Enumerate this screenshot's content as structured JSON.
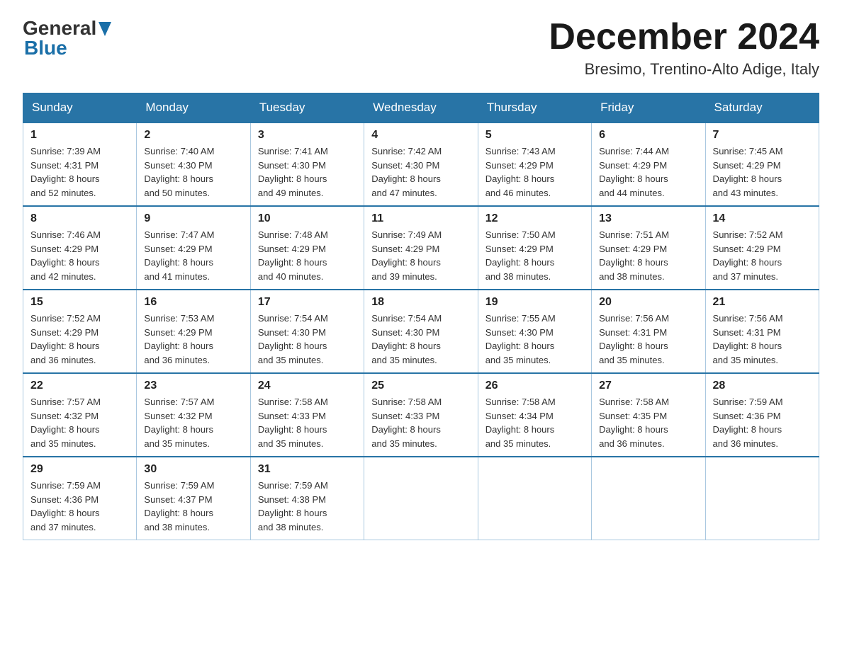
{
  "header": {
    "logo_general": "General",
    "logo_blue": "Blue",
    "month_title": "December 2024",
    "subtitle": "Bresimo, Trentino-Alto Adige, Italy"
  },
  "days_of_week": [
    "Sunday",
    "Monday",
    "Tuesday",
    "Wednesday",
    "Thursday",
    "Friday",
    "Saturday"
  ],
  "weeks": [
    [
      {
        "day": "1",
        "sunrise": "Sunrise: 7:39 AM",
        "sunset": "Sunset: 4:31 PM",
        "daylight": "Daylight: 8 hours",
        "minutes": "and 52 minutes."
      },
      {
        "day": "2",
        "sunrise": "Sunrise: 7:40 AM",
        "sunset": "Sunset: 4:30 PM",
        "daylight": "Daylight: 8 hours",
        "minutes": "and 50 minutes."
      },
      {
        "day": "3",
        "sunrise": "Sunrise: 7:41 AM",
        "sunset": "Sunset: 4:30 PM",
        "daylight": "Daylight: 8 hours",
        "minutes": "and 49 minutes."
      },
      {
        "day": "4",
        "sunrise": "Sunrise: 7:42 AM",
        "sunset": "Sunset: 4:30 PM",
        "daylight": "Daylight: 8 hours",
        "minutes": "and 47 minutes."
      },
      {
        "day": "5",
        "sunrise": "Sunrise: 7:43 AM",
        "sunset": "Sunset: 4:29 PM",
        "daylight": "Daylight: 8 hours",
        "minutes": "and 46 minutes."
      },
      {
        "day": "6",
        "sunrise": "Sunrise: 7:44 AM",
        "sunset": "Sunset: 4:29 PM",
        "daylight": "Daylight: 8 hours",
        "minutes": "and 44 minutes."
      },
      {
        "day": "7",
        "sunrise": "Sunrise: 7:45 AM",
        "sunset": "Sunset: 4:29 PM",
        "daylight": "Daylight: 8 hours",
        "minutes": "and 43 minutes."
      }
    ],
    [
      {
        "day": "8",
        "sunrise": "Sunrise: 7:46 AM",
        "sunset": "Sunset: 4:29 PM",
        "daylight": "Daylight: 8 hours",
        "minutes": "and 42 minutes."
      },
      {
        "day": "9",
        "sunrise": "Sunrise: 7:47 AM",
        "sunset": "Sunset: 4:29 PM",
        "daylight": "Daylight: 8 hours",
        "minutes": "and 41 minutes."
      },
      {
        "day": "10",
        "sunrise": "Sunrise: 7:48 AM",
        "sunset": "Sunset: 4:29 PM",
        "daylight": "Daylight: 8 hours",
        "minutes": "and 40 minutes."
      },
      {
        "day": "11",
        "sunrise": "Sunrise: 7:49 AM",
        "sunset": "Sunset: 4:29 PM",
        "daylight": "Daylight: 8 hours",
        "minutes": "and 39 minutes."
      },
      {
        "day": "12",
        "sunrise": "Sunrise: 7:50 AM",
        "sunset": "Sunset: 4:29 PM",
        "daylight": "Daylight: 8 hours",
        "minutes": "and 38 minutes."
      },
      {
        "day": "13",
        "sunrise": "Sunrise: 7:51 AM",
        "sunset": "Sunset: 4:29 PM",
        "daylight": "Daylight: 8 hours",
        "minutes": "and 38 minutes."
      },
      {
        "day": "14",
        "sunrise": "Sunrise: 7:52 AM",
        "sunset": "Sunset: 4:29 PM",
        "daylight": "Daylight: 8 hours",
        "minutes": "and 37 minutes."
      }
    ],
    [
      {
        "day": "15",
        "sunrise": "Sunrise: 7:52 AM",
        "sunset": "Sunset: 4:29 PM",
        "daylight": "Daylight: 8 hours",
        "minutes": "and 36 minutes."
      },
      {
        "day": "16",
        "sunrise": "Sunrise: 7:53 AM",
        "sunset": "Sunset: 4:29 PM",
        "daylight": "Daylight: 8 hours",
        "minutes": "and 36 minutes."
      },
      {
        "day": "17",
        "sunrise": "Sunrise: 7:54 AM",
        "sunset": "Sunset: 4:30 PM",
        "daylight": "Daylight: 8 hours",
        "minutes": "and 35 minutes."
      },
      {
        "day": "18",
        "sunrise": "Sunrise: 7:54 AM",
        "sunset": "Sunset: 4:30 PM",
        "daylight": "Daylight: 8 hours",
        "minutes": "and 35 minutes."
      },
      {
        "day": "19",
        "sunrise": "Sunrise: 7:55 AM",
        "sunset": "Sunset: 4:30 PM",
        "daylight": "Daylight: 8 hours",
        "minutes": "and 35 minutes."
      },
      {
        "day": "20",
        "sunrise": "Sunrise: 7:56 AM",
        "sunset": "Sunset: 4:31 PM",
        "daylight": "Daylight: 8 hours",
        "minutes": "and 35 minutes."
      },
      {
        "day": "21",
        "sunrise": "Sunrise: 7:56 AM",
        "sunset": "Sunset: 4:31 PM",
        "daylight": "Daylight: 8 hours",
        "minutes": "and 35 minutes."
      }
    ],
    [
      {
        "day": "22",
        "sunrise": "Sunrise: 7:57 AM",
        "sunset": "Sunset: 4:32 PM",
        "daylight": "Daylight: 8 hours",
        "minutes": "and 35 minutes."
      },
      {
        "day": "23",
        "sunrise": "Sunrise: 7:57 AM",
        "sunset": "Sunset: 4:32 PM",
        "daylight": "Daylight: 8 hours",
        "minutes": "and 35 minutes."
      },
      {
        "day": "24",
        "sunrise": "Sunrise: 7:58 AM",
        "sunset": "Sunset: 4:33 PM",
        "daylight": "Daylight: 8 hours",
        "minutes": "and 35 minutes."
      },
      {
        "day": "25",
        "sunrise": "Sunrise: 7:58 AM",
        "sunset": "Sunset: 4:33 PM",
        "daylight": "Daylight: 8 hours",
        "minutes": "and 35 minutes."
      },
      {
        "day": "26",
        "sunrise": "Sunrise: 7:58 AM",
        "sunset": "Sunset: 4:34 PM",
        "daylight": "Daylight: 8 hours",
        "minutes": "and 35 minutes."
      },
      {
        "day": "27",
        "sunrise": "Sunrise: 7:58 AM",
        "sunset": "Sunset: 4:35 PM",
        "daylight": "Daylight: 8 hours",
        "minutes": "and 36 minutes."
      },
      {
        "day": "28",
        "sunrise": "Sunrise: 7:59 AM",
        "sunset": "Sunset: 4:36 PM",
        "daylight": "Daylight: 8 hours",
        "minutes": "and 36 minutes."
      }
    ],
    [
      {
        "day": "29",
        "sunrise": "Sunrise: 7:59 AM",
        "sunset": "Sunset: 4:36 PM",
        "daylight": "Daylight: 8 hours",
        "minutes": "and 37 minutes."
      },
      {
        "day": "30",
        "sunrise": "Sunrise: 7:59 AM",
        "sunset": "Sunset: 4:37 PM",
        "daylight": "Daylight: 8 hours",
        "minutes": "and 38 minutes."
      },
      {
        "day": "31",
        "sunrise": "Sunrise: 7:59 AM",
        "sunset": "Sunset: 4:38 PM",
        "daylight": "Daylight: 8 hours",
        "minutes": "and 38 minutes."
      },
      null,
      null,
      null,
      null
    ]
  ]
}
